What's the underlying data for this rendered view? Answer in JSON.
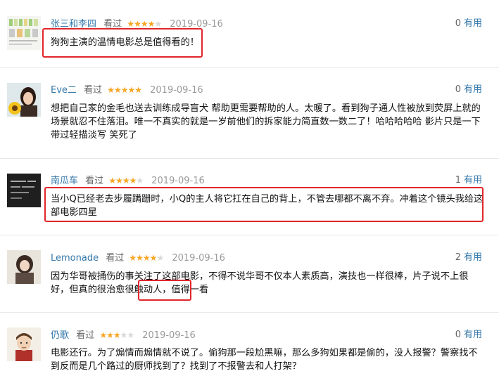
{
  "reviews": [
    {
      "user": "张三和李四",
      "watched": "看过",
      "stars": 4,
      "date": "2019-09-16",
      "useful_count": "0",
      "useful_label": "有用",
      "text": "狗狗主演的温情电影总是值得看的！",
      "avatar": "poster-collage"
    },
    {
      "user": "Eve二",
      "watched": "看过",
      "stars": 5,
      "date": "2019-09-16",
      "useful_count": "0",
      "useful_label": "有用",
      "text": "想把自己家的金毛也送去训练成导盲犬 帮助更需要帮助的人。太暖了。看到狗子通人性被放到荧屏上就的场景就忍不住落泪。唯一不真实的就是一岁前他们的拆家能力简直数一数二了！哈哈哈哈哈 影片只是一下带过轻描淡写 笑死了",
      "avatar": "girl-with-sunflower"
    },
    {
      "user": "南瓜车",
      "watched": "看过",
      "stars": 4,
      "date": "2019-09-16",
      "useful_count": "1",
      "useful_label": "有用",
      "text": "当小Q已经老去步履蹒跚时，小Q的主人将它扛在自己的背上，不管去哪都不离不弃。冲着这个镜头我给这部电影四星",
      "avatar": "dark-text-card"
    },
    {
      "user": "Lemonade",
      "watched": "看过",
      "stars": 4,
      "date": "2019-09-16",
      "useful_count": "2",
      "useful_label": "有用",
      "text": "因为华哥被捅伤的事关注了这部电影，不得不说华哥不仅本人素质高，演技也一样很棒，片子说不上很好，但真的很治愈很触动人，值得一看",
      "avatar": "girl-portrait"
    },
    {
      "user": "仍歌",
      "watched": "看过",
      "stars": 3,
      "date": "2019-09-16",
      "useful_count": "0",
      "useful_label": "有用",
      "text": "电影还行。为了煽情而煽情就不说了。偷狗那一段尬黑嘛，那么多狗如果都是偷的，没人报警？警察找不到反而是几个路过的厨师找到了？找到了不报警去和人打架？",
      "avatar": "cartoon-man"
    }
  ],
  "colors": {
    "link": "#3377aa",
    "star": "#f6a623",
    "highlight": "#e0262b"
  }
}
